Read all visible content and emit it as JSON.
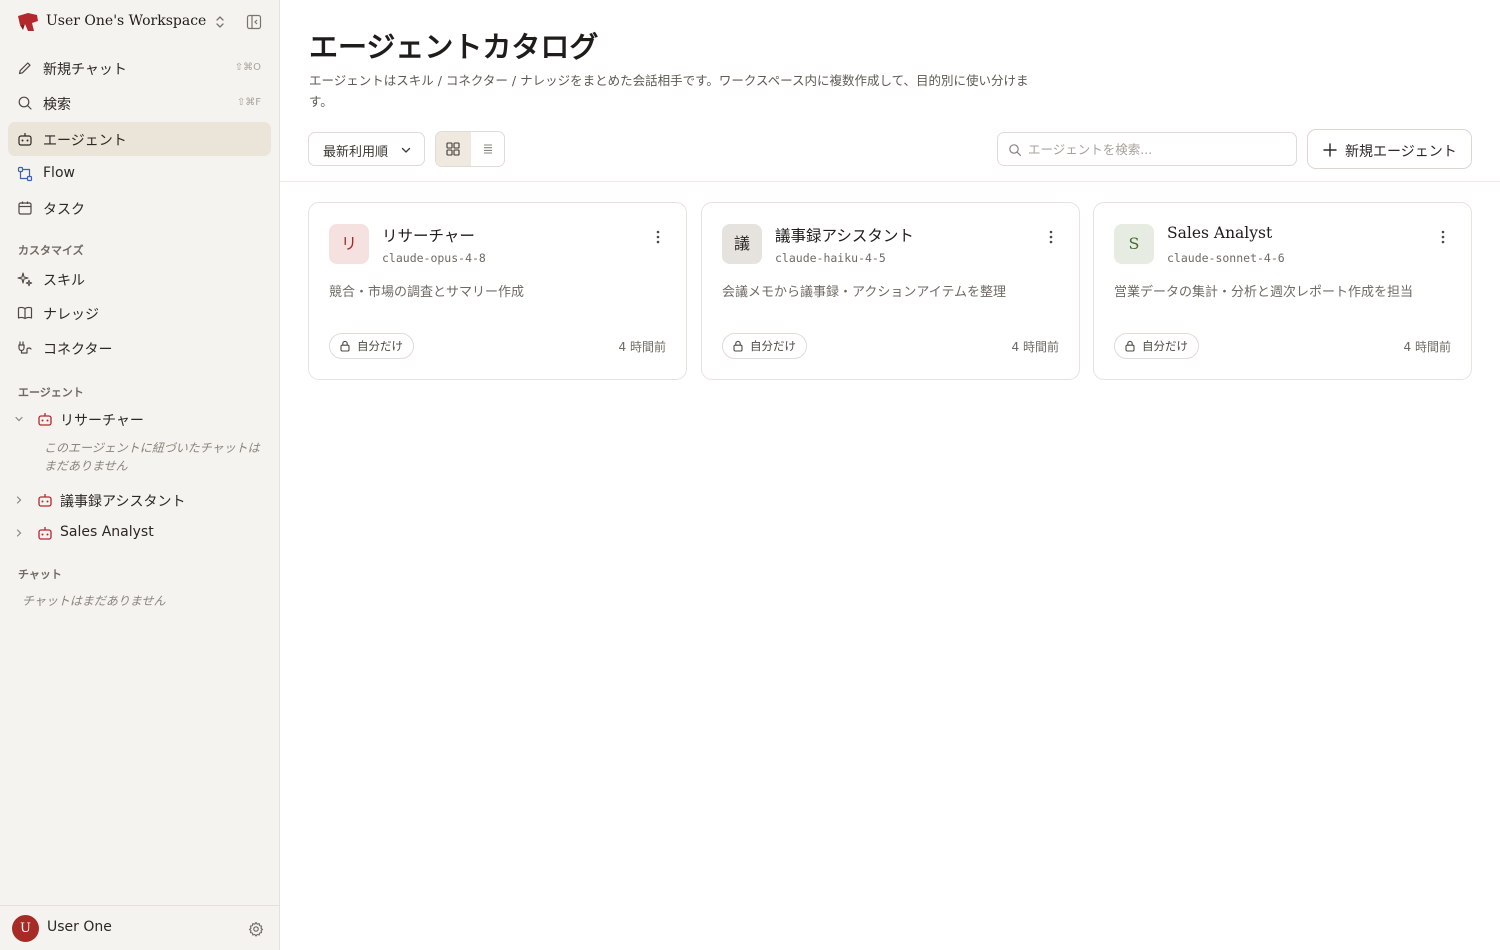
{
  "workspace": {
    "name": "User One's Workspace"
  },
  "nav": {
    "new_chat": {
      "label": "新規チャット",
      "shortcut": "⇧⌘O"
    },
    "search": {
      "label": "検索",
      "shortcut": "⇧⌘F"
    },
    "agents": {
      "label": "エージェント"
    },
    "flow": {
      "label": "Flow"
    },
    "tasks": {
      "label": "タスク"
    }
  },
  "sections": {
    "customize": "カスタマイズ",
    "agents": "エージェント",
    "chats": "チャット"
  },
  "customize_items": {
    "skills": "スキル",
    "knowledge": "ナレッジ",
    "connectors": "コネクター"
  },
  "sidebar_agents": [
    {
      "label": "リサーチャー",
      "expanded": true,
      "empty_note": "このエージェントに紐づいたチャットはまだありません"
    },
    {
      "label": "議事録アシスタント",
      "expanded": false
    },
    {
      "label": "Sales Analyst",
      "expanded": false
    }
  ],
  "chats_empty": "チャットはまだありません",
  "user": {
    "name": "User One",
    "initial": "U"
  },
  "page": {
    "title": "エージェントカタログ",
    "description": "エージェントはスキル / コネクター / ナレッジをまとめた会話相手です。ワークスペース内に複数作成して、目的別に使い分けます。"
  },
  "toolbar": {
    "sort_label": "最新利用順",
    "view_mode": "grid",
    "search_placeholder": "エージェントを検索...",
    "new_agent_label": "新規エージェント"
  },
  "cards": [
    {
      "icon_text": "リ",
      "icon_bg": "#f4e1e0",
      "icon_color": "#a62b26",
      "name": "リサーチャー",
      "model": "claude-opus-4-8",
      "description": "競合・市場の調査とサマリー作成",
      "visibility": "自分だけ",
      "updated": "4 時間前"
    },
    {
      "icon_text": "議",
      "icon_bg": "#e6e3df",
      "icon_color": "#2b2825",
      "name": "議事録アシスタント",
      "model": "claude-haiku-4-5",
      "description": "会議メモから議事録・アクションアイテムを整理",
      "visibility": "自分だけ",
      "updated": "4 時間前"
    },
    {
      "icon_text": "S",
      "icon_bg": "#e7ece3",
      "icon_color": "#4a6b2e",
      "name": "Sales Analyst",
      "model": "claude-sonnet-4-6",
      "description": "営業データの集計・分析と週次レポート作成を担当",
      "visibility": "自分だけ",
      "updated": "4 時間前"
    }
  ],
  "colors": {
    "brand": "#a62b26",
    "active_nav_bg": "#ebe4d8",
    "sidebar_bg": "#f5f3ef"
  }
}
